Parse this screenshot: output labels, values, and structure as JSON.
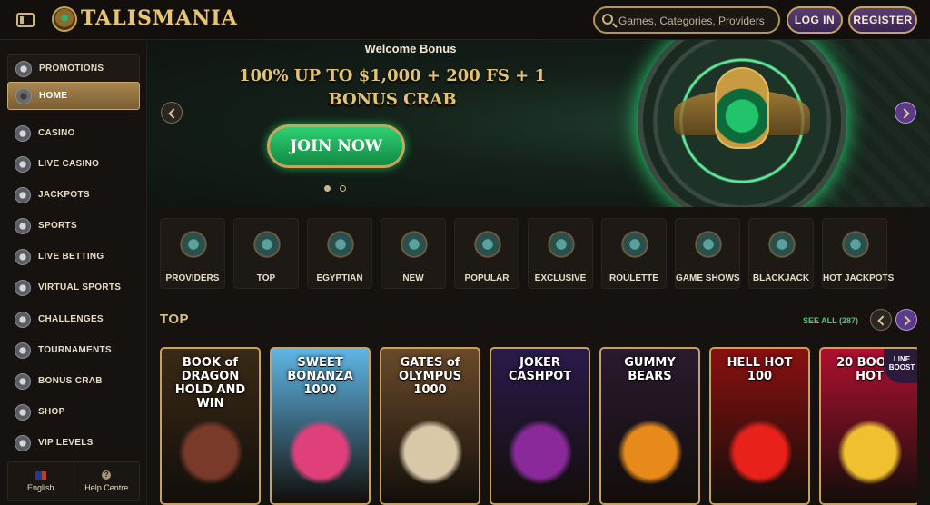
{
  "header": {
    "brand": "TALISMANIA",
    "search_placeholder": "Games, Categories, Providers",
    "login_label": "LOG IN",
    "register_label": "REGISTER"
  },
  "sidebar": {
    "items": [
      {
        "label": "PROMOTIONS",
        "icon": "gift-icon"
      },
      {
        "label": "HOME",
        "icon": "home-icon",
        "active": true
      },
      {
        "label": "CASINO",
        "icon": "chip-icon"
      },
      {
        "label": "LIVE CASINO",
        "icon": "spade-icon"
      },
      {
        "label": "JACKPOTS",
        "icon": "jackpot-icon"
      },
      {
        "label": "SPORTS",
        "icon": "football-icon"
      },
      {
        "label": "LIVE BETTING",
        "icon": "stopwatch-icon"
      },
      {
        "label": "VIRTUAL SPORTS",
        "icon": "gamepad-icon"
      },
      {
        "label": "CHALLENGES",
        "icon": "medal-icon"
      },
      {
        "label": "TOURNAMENTS",
        "icon": "trophy-icon"
      },
      {
        "label": "BONUS CRAB",
        "icon": "crab-icon"
      },
      {
        "label": "SHOP",
        "icon": "shop-icon"
      },
      {
        "label": "VIP LEVELS",
        "icon": "diamond-icon"
      }
    ],
    "footer": {
      "language": "English",
      "help": "Help Centre",
      "help_glyph": "?"
    }
  },
  "banner": {
    "eyebrow": "Welcome Bonus",
    "title_line1": "100% UP TO $1,000 + 200 FS + 1",
    "title_line2": "BONUS CRAB",
    "cta": "JOIN NOW",
    "slides": 2,
    "active_slide": 1
  },
  "categories": [
    {
      "label": "PROVIDERS",
      "icon": "scroll-icon"
    },
    {
      "label": "TOP",
      "icon": "scarab-icon"
    },
    {
      "label": "EGYPTIAN",
      "icon": "eye-of-horus-icon"
    },
    {
      "label": "NEW",
      "icon": "sun-icon"
    },
    {
      "label": "POPULAR",
      "icon": "mask-icon"
    },
    {
      "label": "EXCLUSIVE",
      "icon": "pharaoh-icon"
    },
    {
      "label": "ROULETTE",
      "icon": "roulette-icon"
    },
    {
      "label": "GAME SHOWS",
      "icon": "wheel-icon"
    },
    {
      "label": "BLACKJACK",
      "icon": "spade-icon"
    },
    {
      "label": "HOT JACKPOTS",
      "icon": "flame-icon"
    }
  ],
  "top_section": {
    "title": "TOP",
    "see_all": "SEE ALL (287)"
  },
  "games": [
    {
      "title": "BOOK of DRAGON HOLD AND WIN",
      "bg": "#3a2a16",
      "art": "#7a3a2a"
    },
    {
      "title": "SWEET BONANZA 1000",
      "bg": "#5fb6e6",
      "art": "#e0407a"
    },
    {
      "title": "GATES of OLYMPUS 1000",
      "bg": "#6a4a2a",
      "art": "#d8c8a8"
    },
    {
      "title": "JOKER CASHPOT",
      "bg": "#2a1a4a",
      "art": "#8a2a9a"
    },
    {
      "title": "GUMMY BEARS",
      "bg": "#2a1a2e",
      "art": "#e88a1a"
    },
    {
      "title": "HELL HOT 100",
      "bg": "#8a1010",
      "art": "#e8221a"
    },
    {
      "title": "20 BOOST HOT",
      "bg": "#b01030",
      "art": "#f0c030",
      "badge": "LINE BOOST"
    }
  ]
}
